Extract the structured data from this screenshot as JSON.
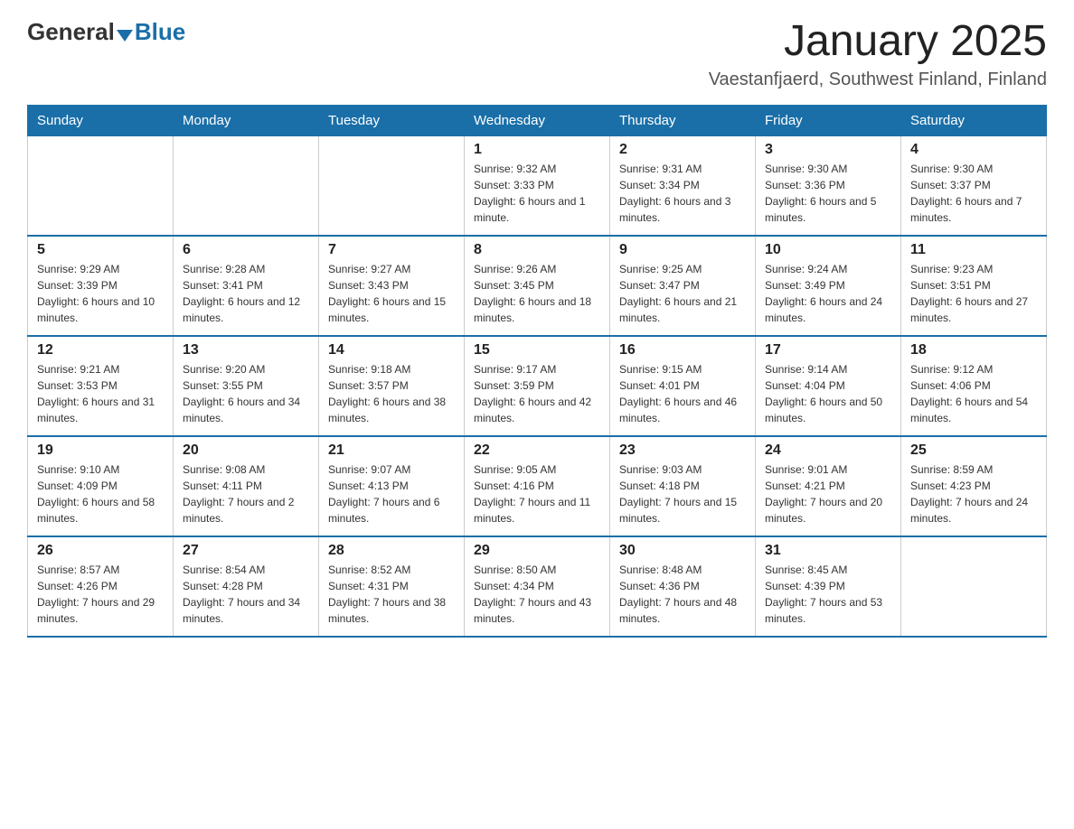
{
  "header": {
    "logo_general": "General",
    "logo_blue": "Blue",
    "month_title": "January 2025",
    "subtitle": "Vaestanfjaerd, Southwest Finland, Finland"
  },
  "days_of_week": [
    "Sunday",
    "Monday",
    "Tuesday",
    "Wednesday",
    "Thursday",
    "Friday",
    "Saturday"
  ],
  "weeks": [
    [
      {
        "day": "",
        "info": ""
      },
      {
        "day": "",
        "info": ""
      },
      {
        "day": "",
        "info": ""
      },
      {
        "day": "1",
        "info": "Sunrise: 9:32 AM\nSunset: 3:33 PM\nDaylight: 6 hours and 1 minute."
      },
      {
        "day": "2",
        "info": "Sunrise: 9:31 AM\nSunset: 3:34 PM\nDaylight: 6 hours and 3 minutes."
      },
      {
        "day": "3",
        "info": "Sunrise: 9:30 AM\nSunset: 3:36 PM\nDaylight: 6 hours and 5 minutes."
      },
      {
        "day": "4",
        "info": "Sunrise: 9:30 AM\nSunset: 3:37 PM\nDaylight: 6 hours and 7 minutes."
      }
    ],
    [
      {
        "day": "5",
        "info": "Sunrise: 9:29 AM\nSunset: 3:39 PM\nDaylight: 6 hours and 10 minutes."
      },
      {
        "day": "6",
        "info": "Sunrise: 9:28 AM\nSunset: 3:41 PM\nDaylight: 6 hours and 12 minutes."
      },
      {
        "day": "7",
        "info": "Sunrise: 9:27 AM\nSunset: 3:43 PM\nDaylight: 6 hours and 15 minutes."
      },
      {
        "day": "8",
        "info": "Sunrise: 9:26 AM\nSunset: 3:45 PM\nDaylight: 6 hours and 18 minutes."
      },
      {
        "day": "9",
        "info": "Sunrise: 9:25 AM\nSunset: 3:47 PM\nDaylight: 6 hours and 21 minutes."
      },
      {
        "day": "10",
        "info": "Sunrise: 9:24 AM\nSunset: 3:49 PM\nDaylight: 6 hours and 24 minutes."
      },
      {
        "day": "11",
        "info": "Sunrise: 9:23 AM\nSunset: 3:51 PM\nDaylight: 6 hours and 27 minutes."
      }
    ],
    [
      {
        "day": "12",
        "info": "Sunrise: 9:21 AM\nSunset: 3:53 PM\nDaylight: 6 hours and 31 minutes."
      },
      {
        "day": "13",
        "info": "Sunrise: 9:20 AM\nSunset: 3:55 PM\nDaylight: 6 hours and 34 minutes."
      },
      {
        "day": "14",
        "info": "Sunrise: 9:18 AM\nSunset: 3:57 PM\nDaylight: 6 hours and 38 minutes."
      },
      {
        "day": "15",
        "info": "Sunrise: 9:17 AM\nSunset: 3:59 PM\nDaylight: 6 hours and 42 minutes."
      },
      {
        "day": "16",
        "info": "Sunrise: 9:15 AM\nSunset: 4:01 PM\nDaylight: 6 hours and 46 minutes."
      },
      {
        "day": "17",
        "info": "Sunrise: 9:14 AM\nSunset: 4:04 PM\nDaylight: 6 hours and 50 minutes."
      },
      {
        "day": "18",
        "info": "Sunrise: 9:12 AM\nSunset: 4:06 PM\nDaylight: 6 hours and 54 minutes."
      }
    ],
    [
      {
        "day": "19",
        "info": "Sunrise: 9:10 AM\nSunset: 4:09 PM\nDaylight: 6 hours and 58 minutes."
      },
      {
        "day": "20",
        "info": "Sunrise: 9:08 AM\nSunset: 4:11 PM\nDaylight: 7 hours and 2 minutes."
      },
      {
        "day": "21",
        "info": "Sunrise: 9:07 AM\nSunset: 4:13 PM\nDaylight: 7 hours and 6 minutes."
      },
      {
        "day": "22",
        "info": "Sunrise: 9:05 AM\nSunset: 4:16 PM\nDaylight: 7 hours and 11 minutes."
      },
      {
        "day": "23",
        "info": "Sunrise: 9:03 AM\nSunset: 4:18 PM\nDaylight: 7 hours and 15 minutes."
      },
      {
        "day": "24",
        "info": "Sunrise: 9:01 AM\nSunset: 4:21 PM\nDaylight: 7 hours and 20 minutes."
      },
      {
        "day": "25",
        "info": "Sunrise: 8:59 AM\nSunset: 4:23 PM\nDaylight: 7 hours and 24 minutes."
      }
    ],
    [
      {
        "day": "26",
        "info": "Sunrise: 8:57 AM\nSunset: 4:26 PM\nDaylight: 7 hours and 29 minutes."
      },
      {
        "day": "27",
        "info": "Sunrise: 8:54 AM\nSunset: 4:28 PM\nDaylight: 7 hours and 34 minutes."
      },
      {
        "day": "28",
        "info": "Sunrise: 8:52 AM\nSunset: 4:31 PM\nDaylight: 7 hours and 38 minutes."
      },
      {
        "day": "29",
        "info": "Sunrise: 8:50 AM\nSunset: 4:34 PM\nDaylight: 7 hours and 43 minutes."
      },
      {
        "day": "30",
        "info": "Sunrise: 8:48 AM\nSunset: 4:36 PM\nDaylight: 7 hours and 48 minutes."
      },
      {
        "day": "31",
        "info": "Sunrise: 8:45 AM\nSunset: 4:39 PM\nDaylight: 7 hours and 53 minutes."
      },
      {
        "day": "",
        "info": ""
      }
    ]
  ]
}
